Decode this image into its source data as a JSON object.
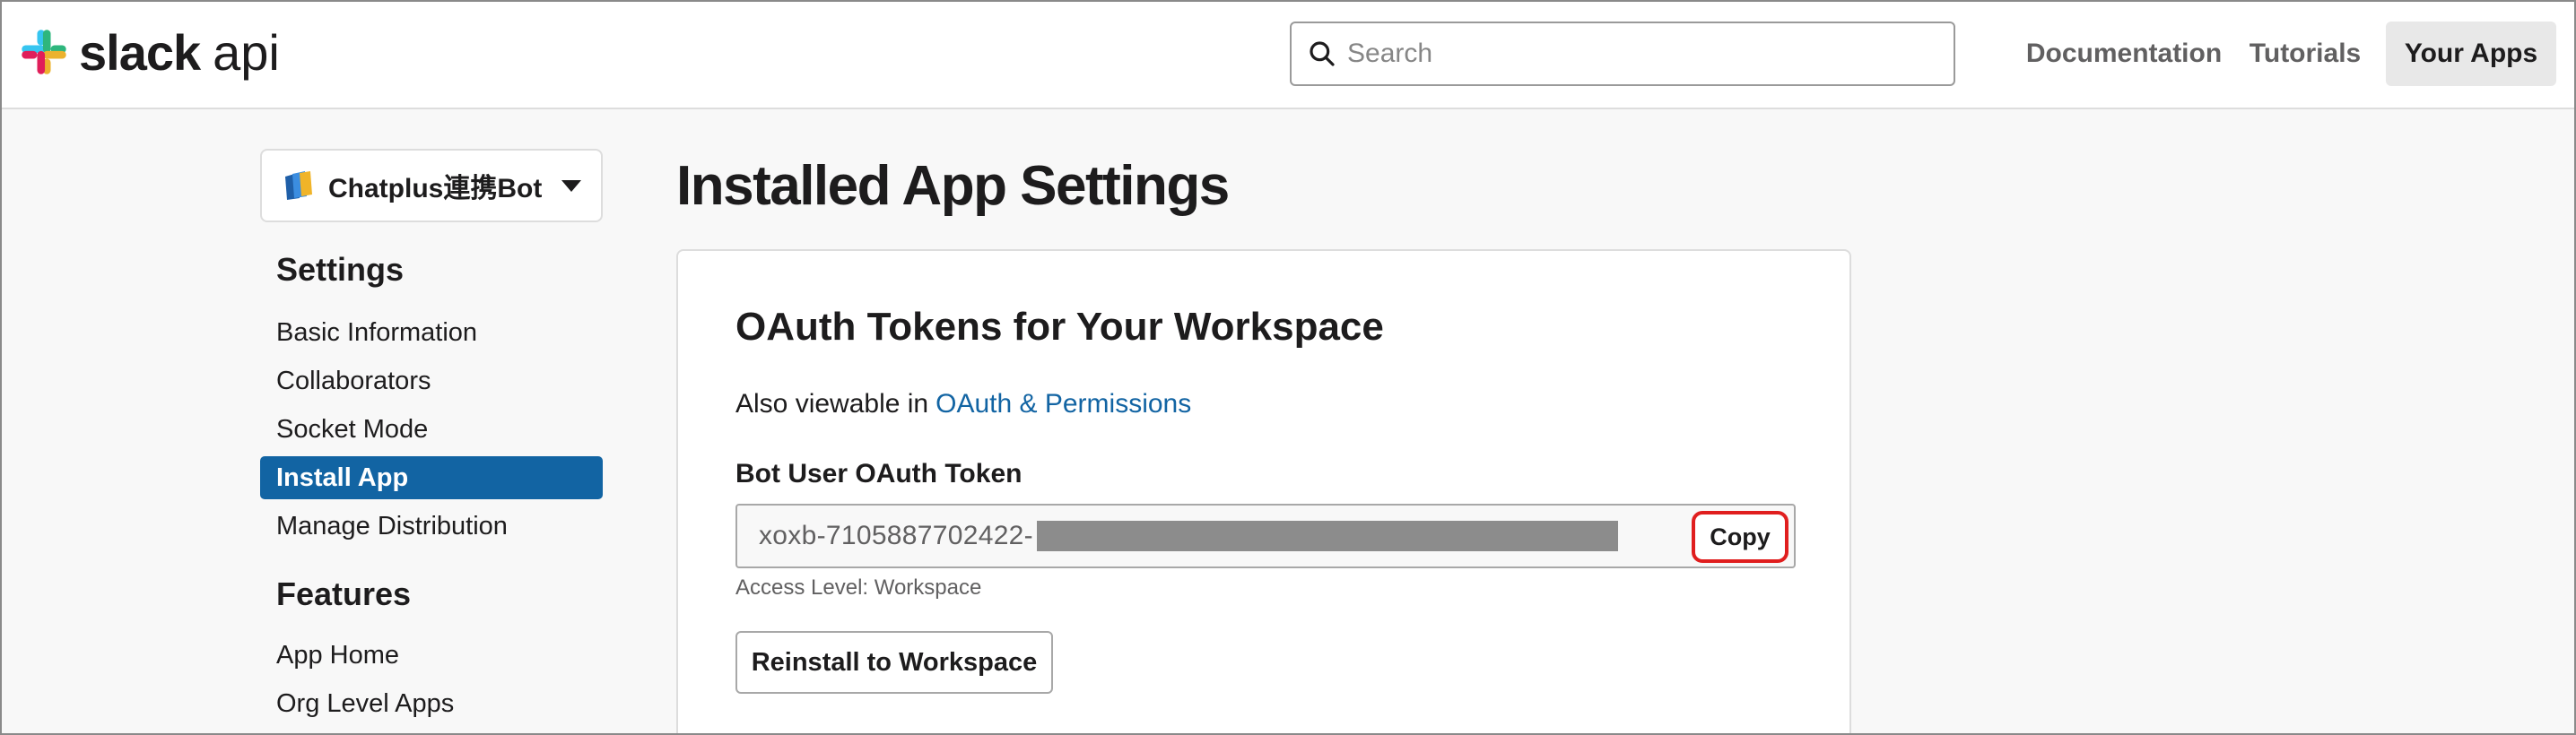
{
  "header": {
    "logo_word": "slack",
    "logo_suffix": "api",
    "search_placeholder": "Search",
    "nav": [
      "Documentation",
      "Tutorials",
      "Your Apps"
    ]
  },
  "sidebar": {
    "app_name": "Chatplus連携Bot",
    "settings_heading": "Settings",
    "settings_items": [
      "Basic Information",
      "Collaborators",
      "Socket Mode",
      "Install App",
      "Manage Distribution"
    ],
    "active_item": "Install App",
    "features_heading": "Features",
    "features_items": [
      "App Home",
      "Org Level Apps"
    ]
  },
  "main": {
    "page_title": "Installed App Settings",
    "card": {
      "title": "OAuth Tokens for Your Workspace",
      "subtitle_prefix": "Also viewable in",
      "subtitle_link": "OAuth & Permissions",
      "token_label": "Bot User OAuth Token",
      "token_value": "xoxb-7105887702422-",
      "copy_label": "Copy",
      "access_level": "Access Level: Workspace",
      "reinstall_label": "Reinstall to Workspace"
    }
  },
  "colors": {
    "accent": "#1264a3",
    "highlight": "#e01e1e",
    "text": "#1d1c1d",
    "muted": "#616061"
  }
}
